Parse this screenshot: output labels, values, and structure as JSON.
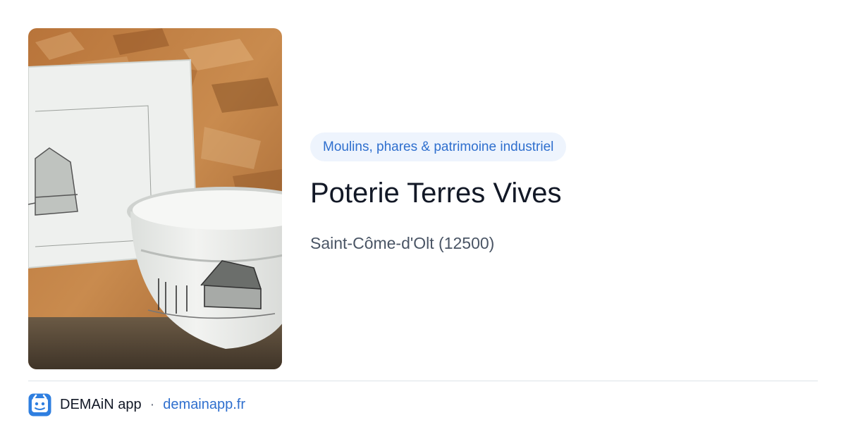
{
  "card": {
    "category": "Moulins, phares & patrimoine industriel",
    "title": "Poterie Terres Vives",
    "location": "Saint-Côme-d'Olt (12500)"
  },
  "footer": {
    "app_name": "DEMAiN app",
    "separator": "·",
    "domain": "demainapp.fr"
  },
  "colors": {
    "accent": "#2f6fce",
    "category_bg": "#eef4fd",
    "title": "#121826",
    "muted": "#4a5565",
    "logo": "#2f7fe0"
  },
  "icons": {
    "logo": "demain-app-icon"
  }
}
